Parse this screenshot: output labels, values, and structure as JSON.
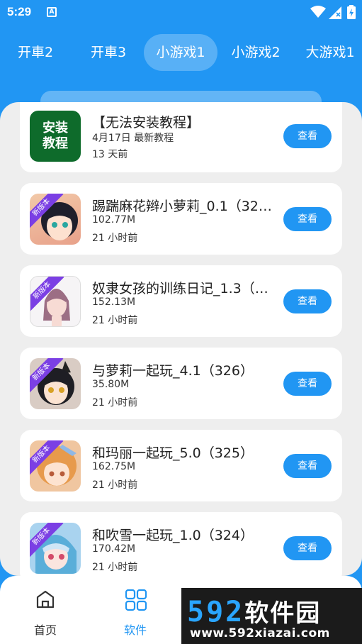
{
  "status_bar": {
    "time": "5:29",
    "notification_letter": "A"
  },
  "tabs": [
    {
      "label": "开車2",
      "active": false
    },
    {
      "label": "开車3",
      "active": false
    },
    {
      "label": "小游戏1",
      "active": true
    },
    {
      "label": "小游戏2",
      "active": false
    },
    {
      "label": "大游戏1",
      "active": false
    }
  ],
  "cards": [
    {
      "thumb_text": "安装\n教程",
      "thumb_line1": "安装",
      "thumb_line2": "教程",
      "title": "【无法安装教程】",
      "meta1": "4月17日 最新教程",
      "meta2": "13 天前",
      "button": "查看"
    },
    {
      "ribbon": "新版本",
      "title": "踢踹麻花辫小萝莉_0.1（32…",
      "meta1": "102.77M",
      "meta2": "21 小时前",
      "button": "查看"
    },
    {
      "ribbon": "新版本",
      "title": "奴隶女孩的训练日记_1.3（…",
      "meta1": "152.13M",
      "meta2": "21 小时前",
      "button": "查看"
    },
    {
      "ribbon": "新版本",
      "title": "与萝莉一起玩_4.1（326）",
      "meta1": "35.80M",
      "meta2": "21 小时前",
      "button": "查看"
    },
    {
      "ribbon": "新版本",
      "title": "和玛丽一起玩_5.0（325）",
      "meta1": "162.75M",
      "meta2": "21 小时前",
      "button": "查看"
    },
    {
      "ribbon": "新版本",
      "title": "和吹雪一起玩_1.0（324）",
      "meta1": "170.42M",
      "meta2": "21 小时前",
      "button": "查看"
    }
  ],
  "bottom_nav": [
    {
      "label": "首页",
      "icon": "home-icon",
      "active": false
    },
    {
      "label": "软件",
      "icon": "apps-grid-icon",
      "active": true
    }
  ],
  "watermark": {
    "brand_num": "592",
    "brand_cn": "软件园",
    "url": "www.592xiazai.com"
  },
  "colors": {
    "primary": "#2196f3",
    "active_tab_bg": "#ffffff40",
    "ribbon": "#7b3fe4",
    "tutorial_green": "#0e6b2b"
  }
}
